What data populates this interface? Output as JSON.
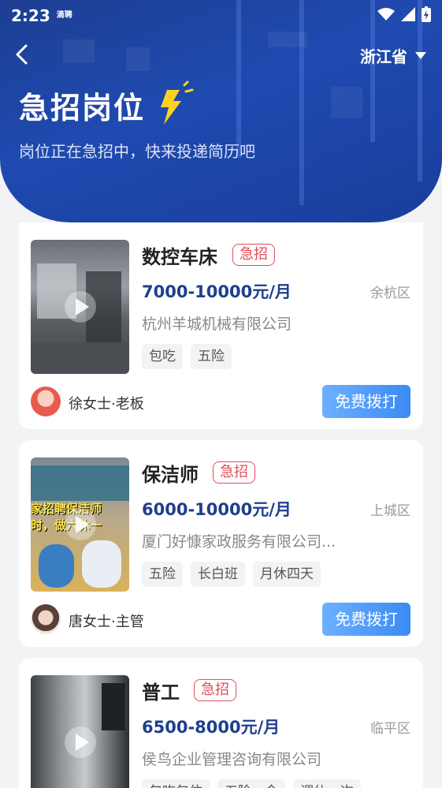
{
  "status": {
    "time": "2:23",
    "badge": "滴聘"
  },
  "header": {
    "province": "浙江省",
    "title": "急招岗位",
    "subtitle": "岗位正在急招中，快来投递简历吧"
  },
  "jobs": [
    {
      "title": "数控车床",
      "urgent": "急招",
      "salary": "7000-10000元/月",
      "district": "余杭区",
      "company": "杭州羊城机械有限公司",
      "tags": [
        "包吃",
        "五险"
      ],
      "contact": "徐女士·老板",
      "call": "免费拨打"
    },
    {
      "title": "保洁师",
      "urgent": "急招",
      "salary": "6000-10000元/月",
      "district": "上城区",
      "company": "厦门好慷家政服务有限公司...",
      "tags": [
        "五险",
        "长白班",
        "月休四天"
      ],
      "contact": "唐女士·主管",
      "call": "免费拨打",
      "thumb_caption": [
        "家招聘保洁师",
        "时，做六休一"
      ]
    },
    {
      "title": "普工",
      "urgent": "急招",
      "salary": "6500-8000元/月",
      "district": "临平区",
      "company": "侯鸟企业管理咨询有限公司",
      "tags": [
        "包吃包住",
        "五险一金",
        "调休一次"
      ]
    }
  ]
}
